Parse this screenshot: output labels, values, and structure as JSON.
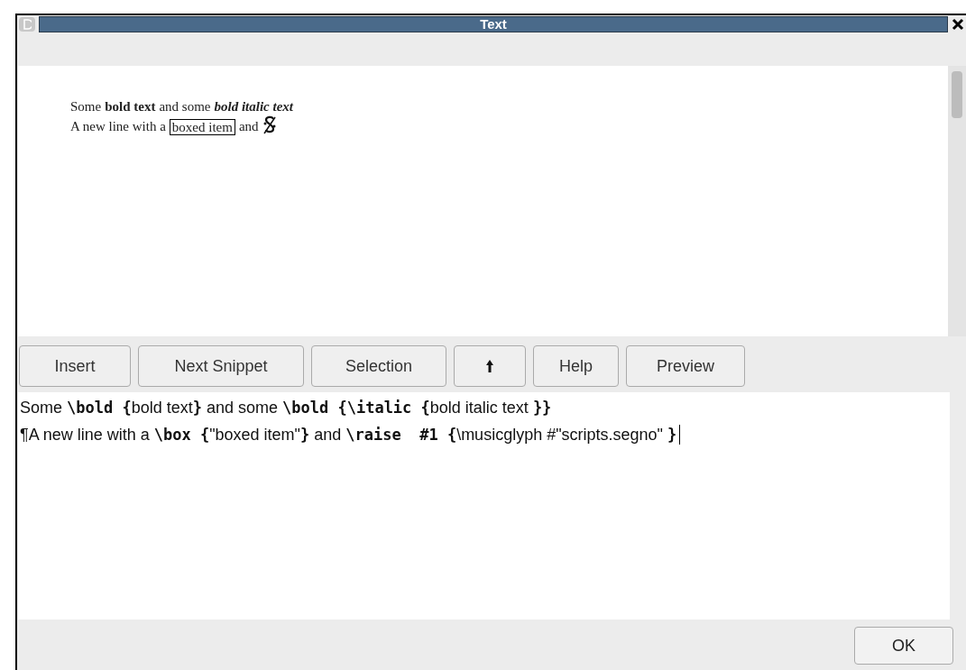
{
  "window": {
    "title": "Text"
  },
  "preview": {
    "lines": [
      [
        {
          "kind": "plain",
          "text": "Some"
        },
        {
          "kind": "bold",
          "text": "bold text"
        },
        {
          "kind": "plain",
          "text": "and some"
        },
        {
          "kind": "bolditalic",
          "text": "bold italic text"
        }
      ],
      [
        {
          "kind": "plain",
          "text": "A new line with a"
        },
        {
          "kind": "boxed",
          "text": "boxed item"
        },
        {
          "kind": "plain",
          "text": "and"
        },
        {
          "kind": "segno"
        }
      ]
    ]
  },
  "buttons": [
    {
      "kind": "text",
      "label": "Insert"
    },
    {
      "kind": "text",
      "label": "Next Snippet"
    },
    {
      "kind": "text",
      "label": "Selection"
    },
    {
      "kind": "up-arrow"
    },
    {
      "kind": "text",
      "label": "Help"
    },
    {
      "kind": "text",
      "label": "Preview"
    }
  ],
  "editor": {
    "lines": [
      [
        {
          "kind": "text",
          "text": "Some"
        },
        {
          "kind": "code_open",
          "text": "\\bold {"
        },
        {
          "kind": "text",
          "text": "bold text"
        },
        {
          "kind": "code_close",
          "text": "}"
        },
        {
          "kind": "text",
          "text": "and some"
        },
        {
          "kind": "code_open",
          "text": "\\bold {\\italic {"
        },
        {
          "kind": "text",
          "text": "bold italic text"
        },
        {
          "kind": "code_close",
          "text": "}}"
        }
      ],
      [
        {
          "kind": "text",
          "text": "¶A new line with a"
        },
        {
          "kind": "code_open",
          "text": "\\box {"
        },
        {
          "kind": "text",
          "text": "\"boxed item\""
        },
        {
          "kind": "code_close",
          "text": "}"
        },
        {
          "kind": "text",
          "text": "and"
        },
        {
          "kind": "code_open",
          "text": "\\raise  #1 {"
        },
        {
          "kind": "text",
          "text": "\\musicglyph #\"scripts.segno\""
        },
        {
          "kind": "code_close",
          "text": "}"
        }
      ]
    ]
  },
  "ok_button": {
    "label": "OK"
  }
}
